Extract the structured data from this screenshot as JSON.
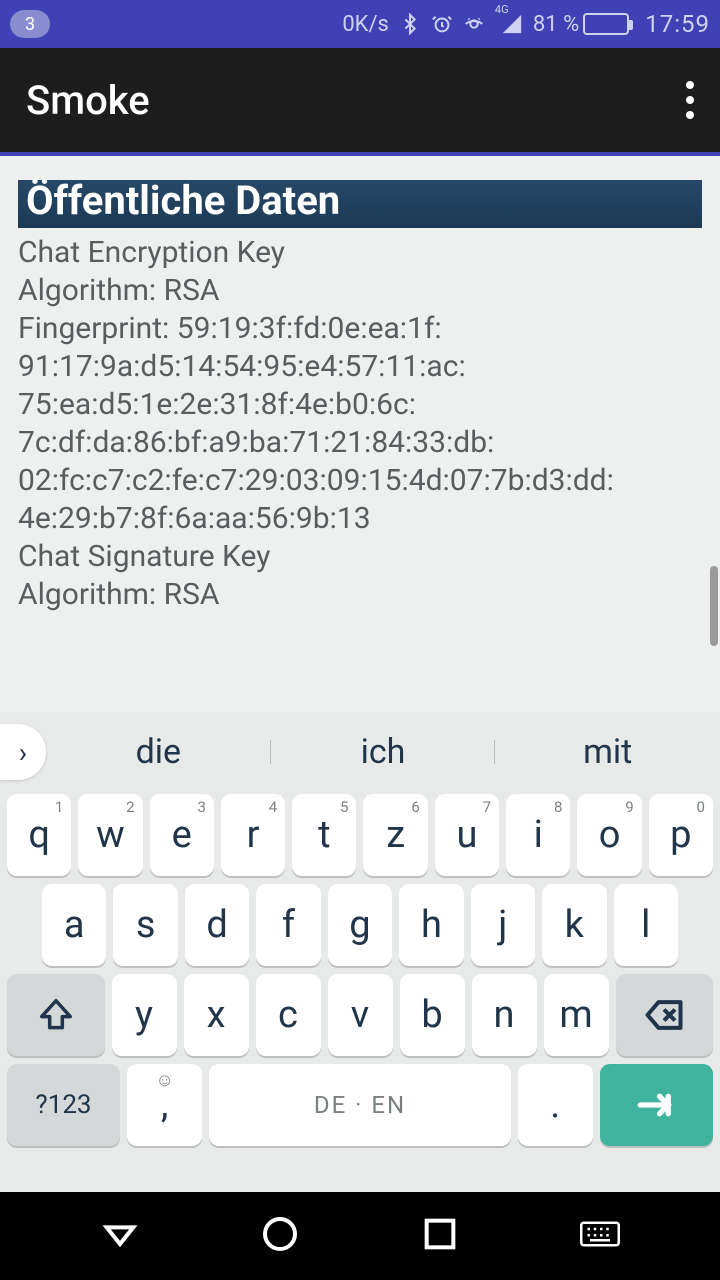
{
  "status": {
    "notification_count": "3",
    "network_speed": "0K/s",
    "battery_pct": "81 %",
    "clock": "17:59",
    "net_label": "4G"
  },
  "appbar": {
    "title": "Smoke"
  },
  "content": {
    "section_header": "Öffentliche Daten",
    "lines": [
      "Chat Encryption Key",
      "Algorithm: RSA",
      "Fingerprint: 59:19:3f:fd:0e:ea:1f:",
      "91:17:9a:d5:14:54:95:e4:57:11:ac:",
      "75:ea:d5:1e:2e:31:8f:4e:b0:6c:",
      "7c:df:da:86:bf:a9:ba:71:21:84:33:db:",
      "02:fc:c7:c2:fe:c7:29:03:09:15:4d:07:7b:d3:dd:",
      "4e:29:b7:8f:6a:aa:56:9b:13",
      "Chat Signature Key",
      "Algorithm: RSA"
    ]
  },
  "keyboard": {
    "suggestions": [
      "die",
      "ich",
      "mit"
    ],
    "row1": [
      {
        "k": "q",
        "s": "1"
      },
      {
        "k": "w",
        "s": "2"
      },
      {
        "k": "e",
        "s": "3"
      },
      {
        "k": "r",
        "s": "4"
      },
      {
        "k": "t",
        "s": "5"
      },
      {
        "k": "z",
        "s": "6"
      },
      {
        "k": "u",
        "s": "7"
      },
      {
        "k": "i",
        "s": "8"
      },
      {
        "k": "o",
        "s": "9"
      },
      {
        "k": "p",
        "s": "0"
      }
    ],
    "row2": [
      "a",
      "s",
      "d",
      "f",
      "g",
      "h",
      "j",
      "k",
      "l"
    ],
    "row3": [
      "y",
      "x",
      "c",
      "v",
      "b",
      "n",
      "m"
    ],
    "symnum_label": "?123",
    "comma": ",",
    "space_label": "DE · EN",
    "period": "."
  }
}
